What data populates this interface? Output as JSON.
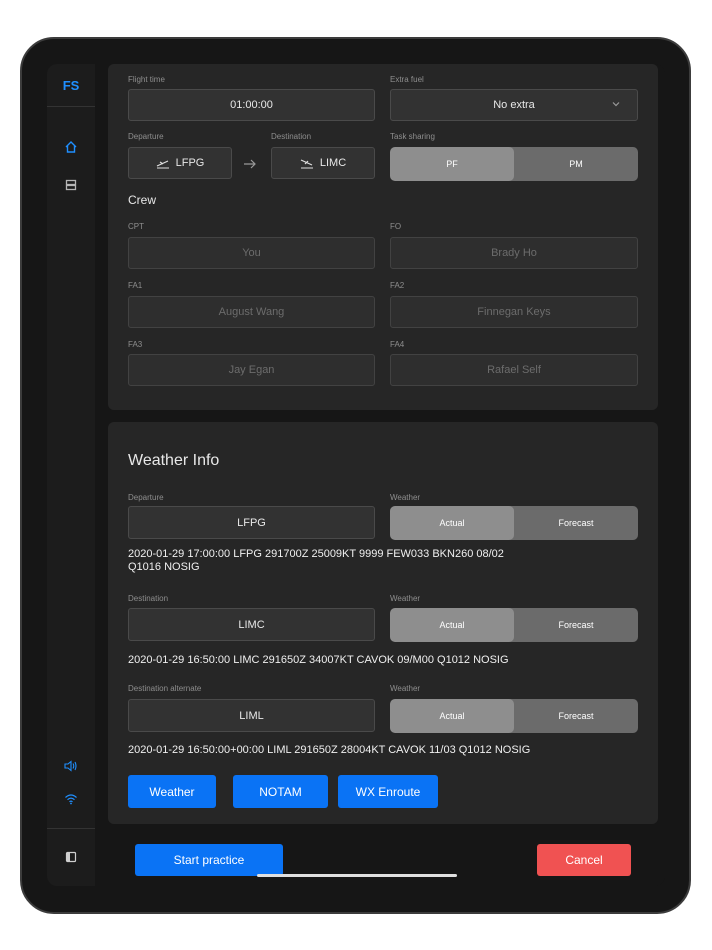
{
  "sidebar": {
    "logo": "FS",
    "nav": [
      "home-icon",
      "database-icon"
    ],
    "bottom_icons": [
      "speaker-icon",
      "wifi-icon"
    ],
    "panel_icon": "sidebar-toggle-icon",
    "accent": "#1f8fff"
  },
  "flight": {
    "flight_time_label": "Flight time",
    "flight_time_value": "01:00:00",
    "extra_fuel_label": "Extra fuel",
    "extra_fuel_value": "No extra",
    "departure_label": "Departure",
    "departure_value": "LFPG",
    "destination_label": "Destination",
    "destination_value": "LIMC",
    "task_sharing_label": "Task sharing",
    "task_options": [
      "PF",
      "PM"
    ],
    "task_selected": "PF"
  },
  "crew": {
    "title": "Crew",
    "cpt_label": "CPT",
    "cpt_value": "You",
    "fo_label": "FO",
    "fo_value": "Brady Ho",
    "fa1_label": "FA1",
    "fa1_value": "August Wang",
    "fa2_label": "FA2",
    "fa2_value": "Finnegan Keys",
    "fa3_label": "FA3",
    "fa3_value": "Jay Egan",
    "fa4_label": "FA4",
    "fa4_value": "Rafael Self"
  },
  "weather": {
    "title": "Weather Info",
    "weather_label": "Weather",
    "options": [
      "Actual",
      "Forecast"
    ],
    "departure_label": "Departure",
    "departure_value": "LFPG",
    "departure_metar_1": "2020-01-29 17:00:00  LFPG 291700Z 25009KT 9999 FEW033 BKN260 08/02",
    "departure_metar_2": "Q1016 NOSIG",
    "destination_label": "Destination",
    "destination_value": "LIMC",
    "destination_metar": "2020-01-29 16:50:00  LIMC 291650Z 34007KT CAVOK 09/M00 Q1012 NOSIG",
    "alternate_label": "Destination alternate",
    "alternate_value": "LIML",
    "alternate_metar": "2020-01-29 16:50:00+00:00  LIML 291650Z 28004KT CAVOK 11/03 Q1012 NOSIG",
    "buttons": [
      "Weather",
      "NOTAM",
      "WX Enroute"
    ]
  },
  "footer": {
    "start_label": "Start practice",
    "cancel_label": "Cancel",
    "start_color": "#0a73f5",
    "cancel_color": "#f05252"
  }
}
